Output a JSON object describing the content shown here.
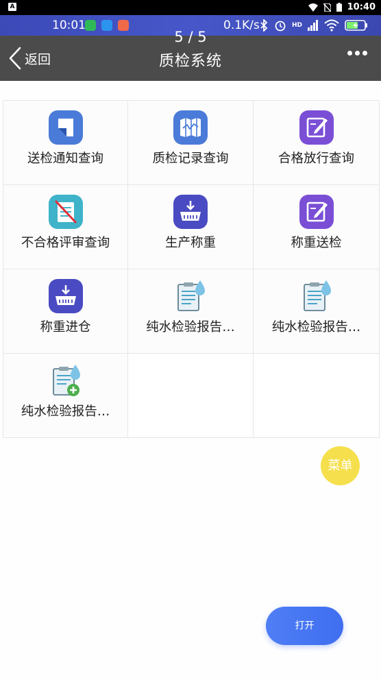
{
  "os_status_bar": {
    "time": "10:40",
    "app_badge": "A"
  },
  "phone_status_bar": {
    "time": "10:01",
    "network_speed": "0.1K/s",
    "signal_label": "HD"
  },
  "header": {
    "page_count": "5 / 5",
    "back_label": "返回",
    "title": "质检系统"
  },
  "grid_items": [
    {
      "label": "送检通知查询",
      "icon": "document-corner-icon"
    },
    {
      "label": "质检记录查询",
      "icon": "map-icon"
    },
    {
      "label": "合格放行查询",
      "icon": "edit-icon"
    },
    {
      "label": "不合格评审查询",
      "icon": "document-cancel-icon"
    },
    {
      "label": "生产称重",
      "icon": "scale-download-icon"
    },
    {
      "label": "称重送检",
      "icon": "edit-icon"
    },
    {
      "label": "称重进仓",
      "icon": "scale-download-icon"
    },
    {
      "label": "纯水检验报告…",
      "icon": "clipboard-water-icon"
    },
    {
      "label": "纯水检验报告…",
      "icon": "clipboard-water-icon"
    },
    {
      "label": "纯水检验报告…",
      "icon": "clipboard-water-add-icon"
    }
  ],
  "fab_menu_label": "菜单",
  "open_button_label": "打开",
  "colors": {
    "header_bg": "#4b4b4b",
    "status_bar_blue": "#4757c9",
    "icon_blue": "#4a7bd8",
    "icon_teal": "#3fb3c9",
    "icon_purple": "#7a4fd6",
    "icon_indigo": "#4a4bc2",
    "menu_yellow": "#f6df4c",
    "open_blue": "#4f7ef5"
  }
}
